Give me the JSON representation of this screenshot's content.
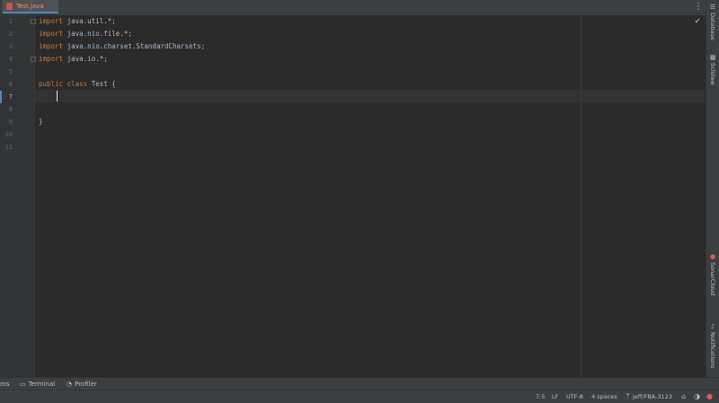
{
  "tabs": [
    {
      "label": "Test.java",
      "icon": "java-class-icon"
    }
  ],
  "tab_more_icon": "vertical-ellipsis-icon",
  "editor": {
    "line_numbers": [
      "1",
      "2",
      "3",
      "4",
      "5",
      "6",
      "7",
      "8",
      "9",
      "10",
      "11"
    ],
    "current_line": "7",
    "code": [
      {
        "kw": "import",
        "rest": " java.util.*;"
      },
      {
        "kw": "import",
        "rest": " java.nio.file.*;"
      },
      {
        "kw": "import",
        "rest": " java.nio.charset.StandardCharsets;"
      },
      {
        "kw": "import",
        "rest": " java.io.*;"
      },
      {
        "kw": "",
        "rest": ""
      },
      {
        "kw": "public class",
        "rest": " Test {"
      },
      {
        "kw": "",
        "rest": ""
      },
      {
        "kw": "",
        "rest": ""
      },
      {
        "kw": "",
        "rest": "}"
      }
    ],
    "inspection_status_icon": "checkmark-icon"
  },
  "right_tools": [
    {
      "label": "Database",
      "icon": "database-icon"
    },
    {
      "label": "SciView",
      "icon": "grid-icon"
    },
    {
      "label": "SonarCloud",
      "icon": "sonar-icon"
    },
    {
      "label": "Notifications",
      "icon": "bell-icon"
    }
  ],
  "bottom_tools": [
    {
      "label": "ms",
      "icon": ""
    },
    {
      "label": "Terminal",
      "icon": "terminal-icon"
    },
    {
      "label": "Profiler",
      "icon": "profiler-icon"
    }
  ],
  "status": {
    "position": "7:5",
    "line_separator": "LF",
    "encoding": "UTF-8",
    "indent": "4 spaces",
    "branch": "jeff/FBA-3123"
  },
  "colors": {
    "keyword": "#cc7832",
    "identifier": "#a9b7c6",
    "editor_bg": "#2b2b2b",
    "chrome_bg": "#3c3f41"
  }
}
